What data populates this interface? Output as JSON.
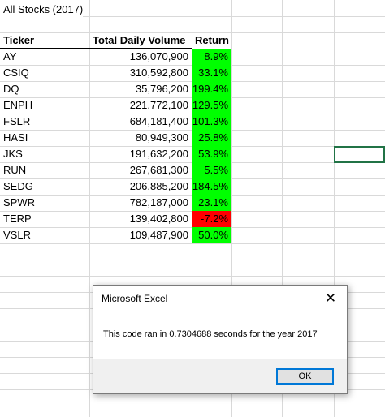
{
  "sheet": {
    "title": "All Stocks (2017)",
    "headers": {
      "ticker": "Ticker",
      "volume": "Total Daily Volume",
      "return": "Return"
    },
    "rows": [
      {
        "ticker": "AY",
        "volume": "136,070,900",
        "return": "8.9%",
        "status": "positive"
      },
      {
        "ticker": "CSIQ",
        "volume": "310,592,800",
        "return": "33.1%",
        "status": "positive"
      },
      {
        "ticker": "DQ",
        "volume": "35,796,200",
        "return": "199.4%",
        "status": "positive"
      },
      {
        "ticker": "ENPH",
        "volume": "221,772,100",
        "return": "129.5%",
        "status": "positive"
      },
      {
        "ticker": "FSLR",
        "volume": "684,181,400",
        "return": "101.3%",
        "status": "positive"
      },
      {
        "ticker": "HASI",
        "volume": "80,949,300",
        "return": "25.8%",
        "status": "positive"
      },
      {
        "ticker": "JKS",
        "volume": "191,632,200",
        "return": "53.9%",
        "status": "positive"
      },
      {
        "ticker": "RUN",
        "volume": "267,681,300",
        "return": "5.5%",
        "status": "positive"
      },
      {
        "ticker": "SEDG",
        "volume": "206,885,200",
        "return": "184.5%",
        "status": "positive"
      },
      {
        "ticker": "SPWR",
        "volume": "782,187,000",
        "return": "23.1%",
        "status": "positive"
      },
      {
        "ticker": "TERP",
        "volume": "139,402,800",
        "return": "-7.2%",
        "status": "negative"
      },
      {
        "ticker": "VSLR",
        "volume": "109,487,900",
        "return": "50.0%",
        "status": "positive"
      }
    ]
  },
  "colors": {
    "positive": "#00ff00",
    "negative": "#ff0000",
    "selection_border": "#217346",
    "gridline": "#d9d9d9",
    "dialog_button_border": "#0078d7"
  },
  "dialog": {
    "title": "Microsoft Excel",
    "message": "This code ran in 0.7304688 seconds for the year 2017",
    "ok_label": "OK",
    "close_icon": "close-icon"
  }
}
